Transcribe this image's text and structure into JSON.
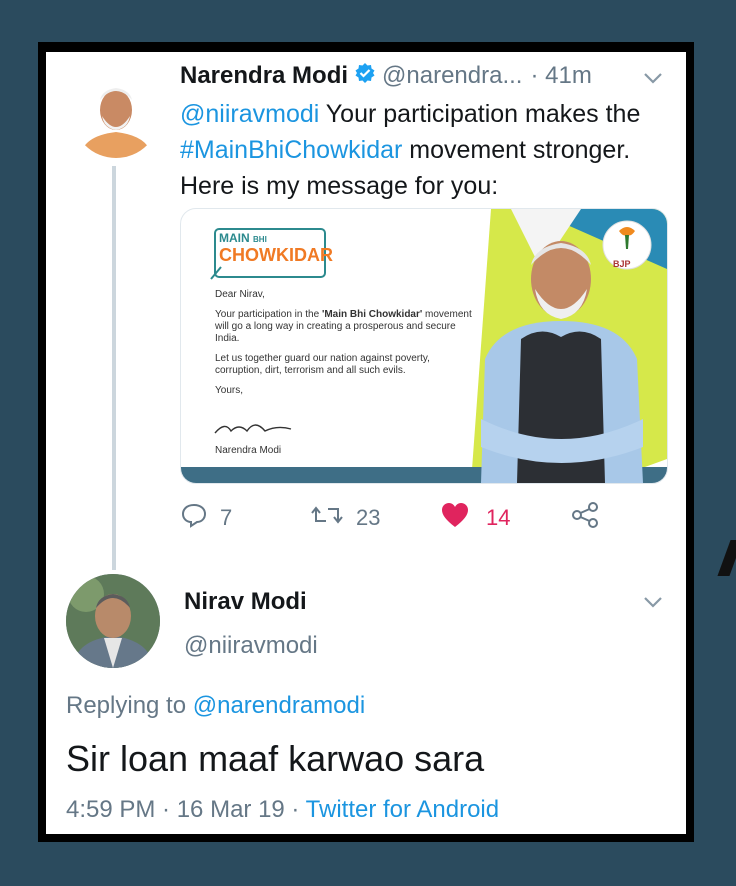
{
  "tweet1": {
    "name": "Narendra Modi",
    "handle": "@narendra...",
    "time": "· 41m",
    "mention": "@niiravmodi",
    "text_part1": " Your participation makes the ",
    "hashtag": "#MainBhiChowkidar",
    "text_part2": " movement stronger. Here is my message for you:",
    "media": {
      "logo_line1": "MAIN",
      "logo_line1b": "BHI",
      "logo_line2": "CHOWKIDAR",
      "party_badge": "BJP",
      "greeting": "Dear Nirav,",
      "para1_a": "Your participation in the ",
      "para1_b": "'Main Bhi Chowkidar'",
      "para1_c": " movement will go a long way in creating a prosperous and secure India.",
      "para2": "Let us together guard our nation against poverty, corruption, dirt, terrorism and all such evils.",
      "closing": "Yours,",
      "signer": "Narendra Modi"
    },
    "replies": "7",
    "retweets": "23",
    "likes": "14"
  },
  "tweet2": {
    "name": "Nirav Modi",
    "handle": "@niiravmodi",
    "replying_label": "Replying to ",
    "replying_to": "@narendramodi",
    "text": "Sir loan maaf karwao sara",
    "timestamp": "4:59 PM · 16 Mar 19 · ",
    "source": "Twitter for Android"
  },
  "colors": {
    "link": "#1b95e0",
    "like": "#e0245e",
    "verified": "#1da1f2",
    "background": "#2b4b5e"
  }
}
